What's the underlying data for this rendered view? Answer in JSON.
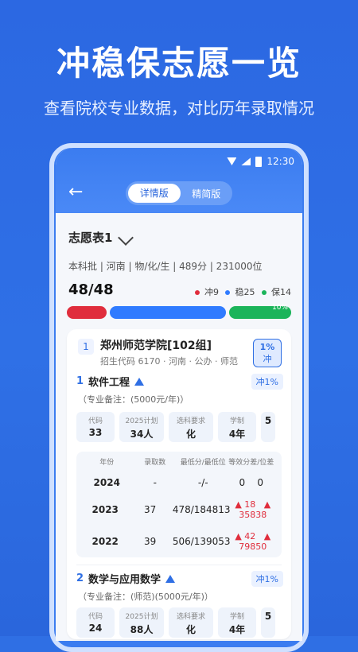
{
  "hero": {
    "title": "冲稳保志愿一览",
    "subtitle": "查看院校专业数据，对比历年录取情况"
  },
  "status": {
    "time": "12:30"
  },
  "header": {
    "tabs": [
      {
        "label": "详情版",
        "active": true
      },
      {
        "label": "精简版",
        "active": false
      }
    ]
  },
  "plan": {
    "title": "志愿表1",
    "meta": "本科批 | 河南 | 物/化/生 | 489分 | 231000位",
    "count": "48/48",
    "legend": [
      {
        "label": "冲9",
        "color": "#e02d3c"
      },
      {
        "label": "稳25",
        "color": "#2f7bff"
      },
      {
        "label": "保14",
        "color": "#1bb45a"
      }
    ],
    "bar_pct": "10%"
  },
  "card": {
    "index": "1",
    "school": "郑州师范学院[102组]",
    "school_sub": "招生代码 6170 · 河南 · 公办 · 师范",
    "badge_pct": "1%",
    "badge_label": "冲",
    "majors": [
      {
        "index": "1",
        "name": "软件工程",
        "pill": "冲1%",
        "remark": "（专业备注：(5000元/年)）",
        "stats": [
          {
            "label": "代码",
            "value": "33"
          },
          {
            "label": "2025计划",
            "value": "34人"
          },
          {
            "label": "选科要求",
            "value": "化"
          },
          {
            "label": "学制",
            "value": "4年"
          },
          {
            "label": "",
            "value": "5"
          }
        ],
        "table": {
          "headers": [
            "年份",
            "录取数",
            "最低分/最低位",
            "等效分差/位差"
          ],
          "rows": [
            {
              "year": "2024",
              "count": "-",
              "score": "-/-",
              "diff1": "0",
              "diff2": "0"
            },
            {
              "year": "2023",
              "count": "37",
              "score": "478/184813",
              "diff1": "18",
              "diff2": "35838"
            },
            {
              "year": "2022",
              "count": "39",
              "score": "506/139053",
              "diff1": "42",
              "diff2": "79850"
            }
          ]
        }
      },
      {
        "index": "2",
        "name": "数学与应用数学",
        "pill": "冲1%",
        "remark": "（专业备注：(师范)(5000元/年)）",
        "stats": [
          {
            "label": "代码",
            "value": "24"
          },
          {
            "label": "2025计划",
            "value": "88人"
          },
          {
            "label": "选科要求",
            "value": "化"
          },
          {
            "label": "学制",
            "value": "4年"
          },
          {
            "label": "",
            "value": "5"
          }
        ]
      }
    ]
  }
}
